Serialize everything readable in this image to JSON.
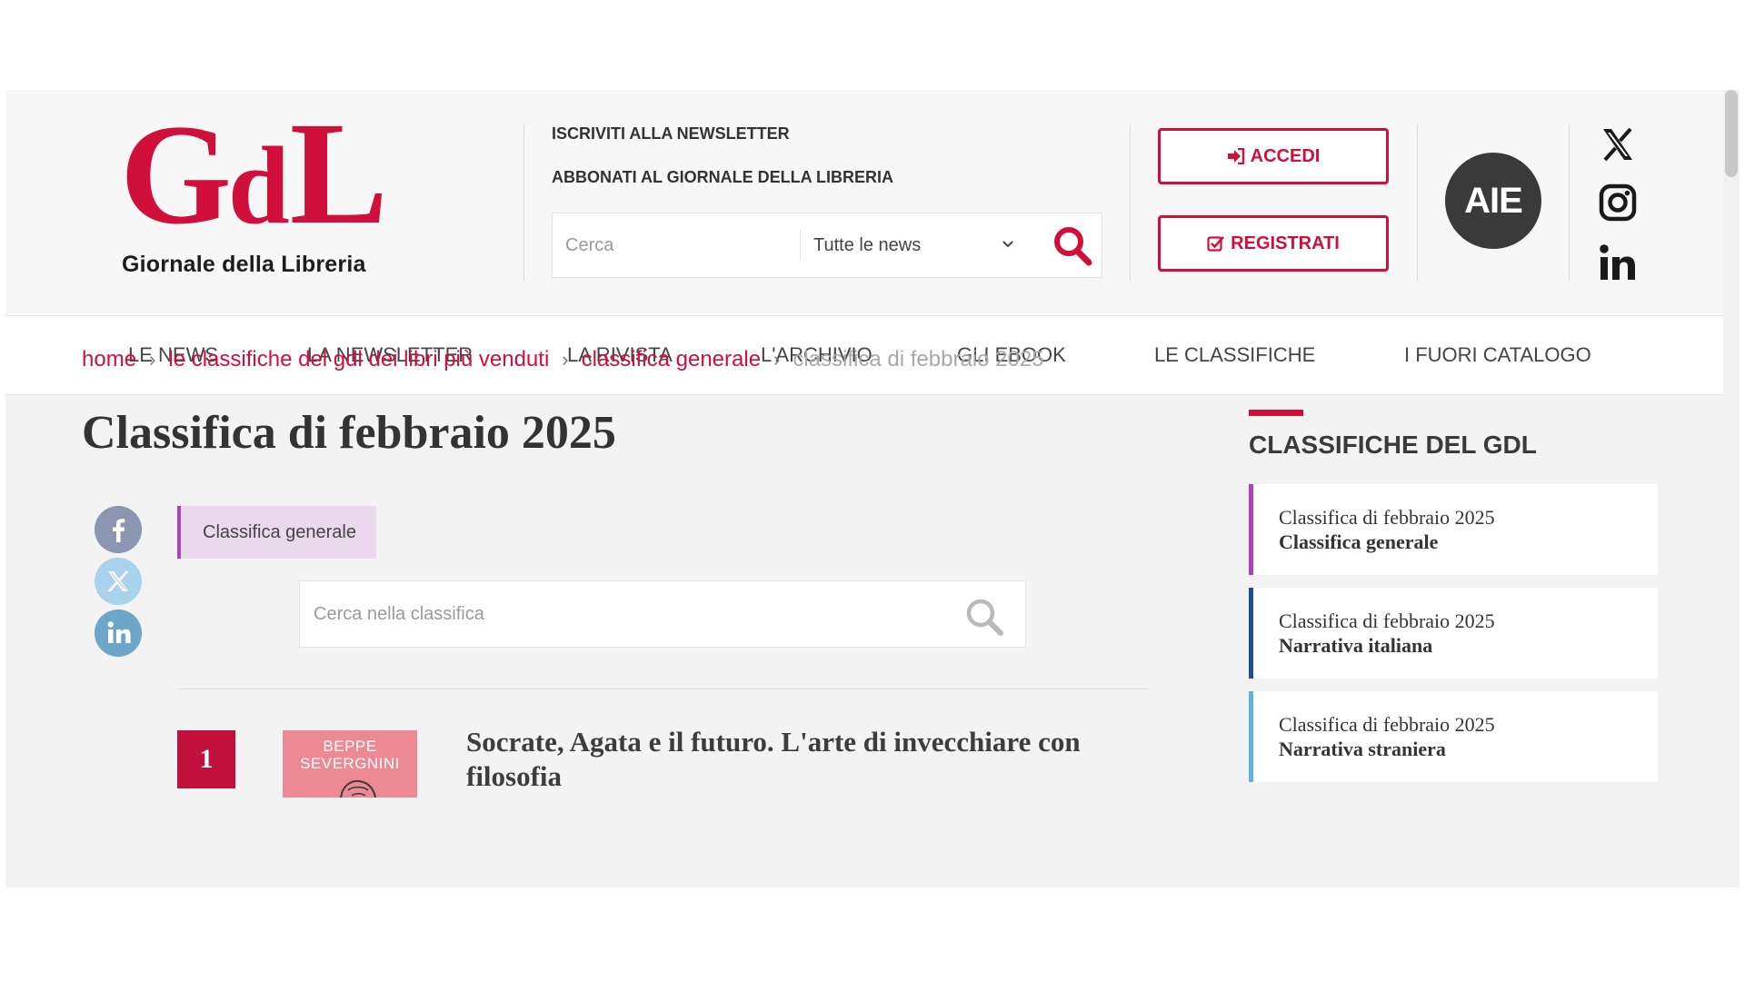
{
  "colors": {
    "brand": "#d0103a",
    "tag_accent": "#a945b8",
    "tag_bg": "#ead8ec",
    "side_italiana": "#1f4d9a",
    "side_straniera": "#5ab4dc"
  },
  "header": {
    "logo_mark": {
      "g": "G",
      "d": "d",
      "l": "L"
    },
    "logo_sub": "Giornale della Libreria",
    "link_newsletter": "ISCRIVITI ALLA NEWSLETTER",
    "link_abbonati": "ABBONATI AL GIORNALE DELLA LIBRERIA",
    "search": {
      "placeholder": "Cerca",
      "scope": "Tutte le news",
      "icon": "search-icon"
    },
    "accedi_label": "ACCEDI",
    "accedi_icon": "sign-in-icon",
    "registrati_label": "REGISTRATI",
    "registrati_icon": "check-square-icon",
    "aie_logo": "AIE",
    "social_icons": [
      "x-icon",
      "instagram-icon",
      "linkedin-icon"
    ]
  },
  "nav": {
    "items": [
      "LE NEWS",
      "LA NEWSLETTER",
      "LA RIVISTA",
      "L'ARCHIVIO",
      "GLI EBOOK",
      "LE CLASSIFICHE",
      "I FUORI CATALOGO"
    ]
  },
  "breadcrumb": {
    "items": [
      "home",
      "le classifiche del gdl dei libri più venduti",
      "classifica generale"
    ],
    "current": "classifica di febbraio 2025"
  },
  "main": {
    "title": "Classifica di febbraio 2025",
    "share_icons": [
      "facebook-icon",
      "x-icon",
      "linkedin-icon"
    ],
    "tag": "Classifica generale",
    "search_placeholder": "Cerca nella classifica",
    "entries": [
      {
        "rank": "1",
        "cover_author": "BEPPE SEVERGNINI",
        "title": "Socrate, Agata e il futuro. L'arte di invecchiare con filosofia"
      }
    ]
  },
  "sidebar": {
    "heading": "CLASSIFICHE DEL GDL",
    "items": [
      {
        "line1": "Classifica di febbraio 2025",
        "line2": "Classifica generale"
      },
      {
        "line1": "Classifica di febbraio 2025",
        "line2": "Narrativa italiana"
      },
      {
        "line1": "Classifica di febbraio 2025",
        "line2": "Narrativa straniera"
      }
    ]
  }
}
